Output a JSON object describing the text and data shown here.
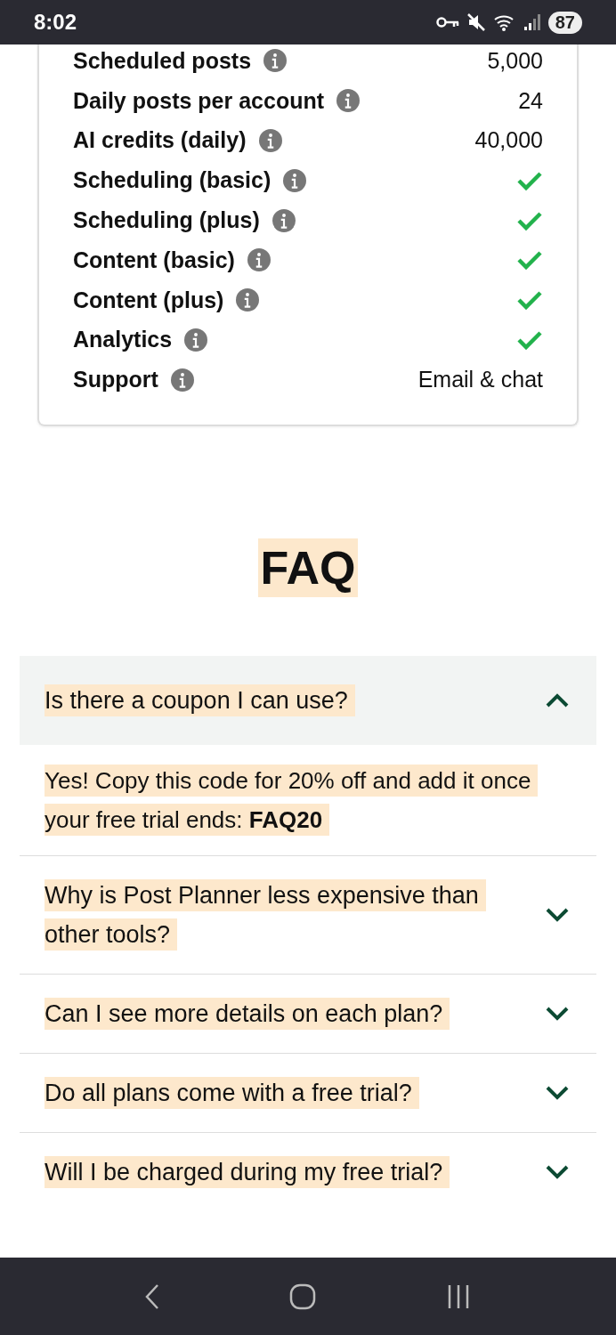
{
  "status_bar": {
    "time": "8:02",
    "battery": "87"
  },
  "features": [
    {
      "label": "Scheduled posts",
      "kind": "value",
      "value": "5,000"
    },
    {
      "label": "Daily posts per account",
      "kind": "value",
      "value": "24"
    },
    {
      "label": "AI credits (daily)",
      "kind": "value",
      "value": "40,000"
    },
    {
      "label": "Scheduling (basic)",
      "kind": "check"
    },
    {
      "label": "Scheduling (plus)",
      "kind": "check"
    },
    {
      "label": "Content (basic)",
      "kind": "check"
    },
    {
      "label": "Content (plus)",
      "kind": "check"
    },
    {
      "label": "Analytics",
      "kind": "check"
    },
    {
      "label": "Support",
      "kind": "value",
      "value": "Email & chat"
    }
  ],
  "faq": {
    "title": "FAQ",
    "items": [
      {
        "question": "Is there a coupon I can use?",
        "expanded": true,
        "answer": "Yes! Copy this code for 20% off and add it once your free trial ends: **FAQ20**"
      },
      {
        "question": "Why is Post Planner less expensive than other tools?",
        "expanded": false
      },
      {
        "question": "Can I see more details on each plan?",
        "expanded": false
      },
      {
        "question": "Do all plans come with a free trial?",
        "expanded": false
      },
      {
        "question": "Will I be charged during my free trial?",
        "expanded": false
      }
    ]
  }
}
